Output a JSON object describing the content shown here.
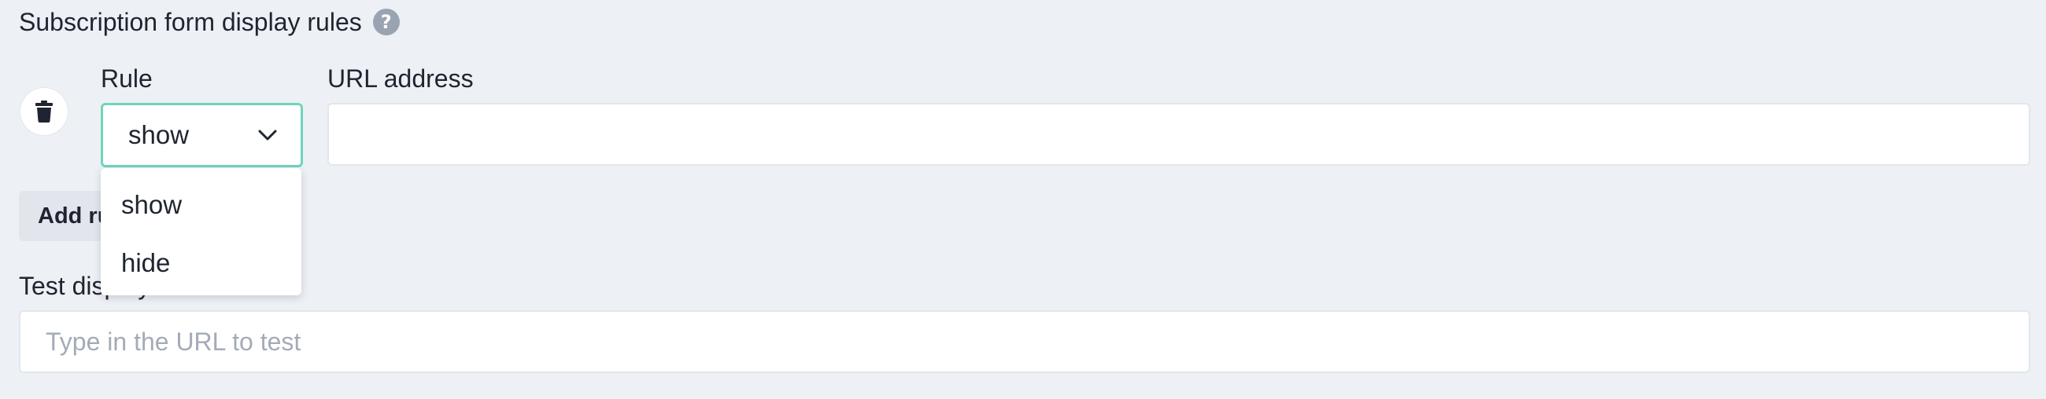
{
  "section": {
    "title": "Subscription form display rules",
    "help_icon": "question-icon"
  },
  "rule_row": {
    "delete_icon": "trash-icon",
    "rule_label": "Rule",
    "rule_value": "show",
    "rule_chevron_icon": "chevron-down-icon",
    "url_label": "URL address",
    "url_value": ""
  },
  "dropdown": {
    "options": [
      "show",
      "hide"
    ]
  },
  "add_rule_label": "Add rule",
  "test": {
    "label": "Test display",
    "placeholder": "Type in the URL to test"
  },
  "colors": {
    "background": "#edf0f4",
    "select_border_focus": "#6fd4bd",
    "text": "#1f2430",
    "placeholder": "#a3abb8",
    "help_icon_bg": "#9aa3b2",
    "button_bg": "#e2e6ec"
  }
}
